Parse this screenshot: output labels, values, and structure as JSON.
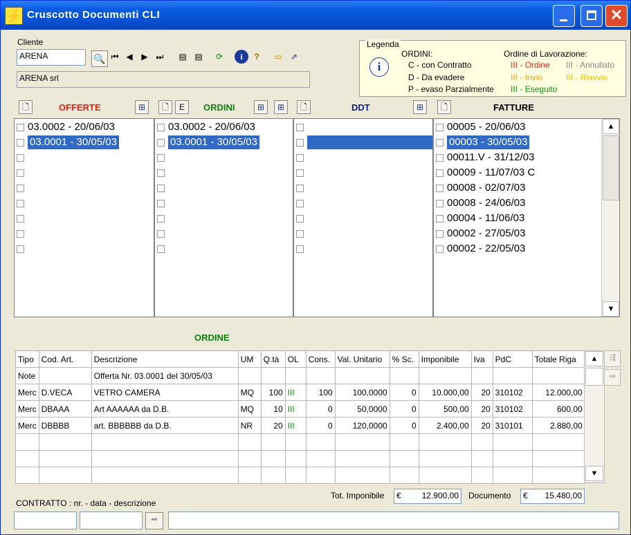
{
  "window": {
    "title": "Cruscotto Documenti CLI"
  },
  "cliente": {
    "label": "Cliente",
    "code": "ARENA",
    "name": "ARENA srl"
  },
  "legend": {
    "title": "Legenda",
    "ordini_title": "ORDINI:",
    "ordini": [
      "C - con Contratto",
      "D - Da evadere",
      "P - evaso Parzialmente"
    ],
    "ol_title": "Ordine di Lavorazione:",
    "ol": [
      {
        "mark": "III",
        "label": "- Ordine",
        "color": "#e02010"
      },
      {
        "mark": "III",
        "label": "- Annullato",
        "color": "#888888"
      },
      {
        "mark": "III",
        "label": "- Invio",
        "color": "#f0a020"
      },
      {
        "mark": "III",
        "label": "- Riavvio",
        "color": "#e8c000"
      },
      {
        "mark": "III",
        "label": "- Eseguito",
        "color": "#109010"
      }
    ]
  },
  "columns": {
    "offerte": {
      "title": "OFFERTE",
      "color": "#e02010",
      "items": [
        "03.0002 - 20/06/03",
        "03.0001 - 30/05/03",
        "",
        "",
        "",
        "",
        "",
        "",
        ""
      ]
    },
    "ordini": {
      "title": "ORDINI",
      "color": "#108010",
      "e_label": "E",
      "items": [
        "03.0002 - 20/06/03",
        "03.0001 - 30/05/03",
        "",
        "",
        "",
        "",
        "",
        "",
        ""
      ]
    },
    "ddt": {
      "title": "DDT",
      "color": "#10208a",
      "items": [
        "",
        "",
        "",
        "",
        "",
        "",
        "",
        "",
        ""
      ]
    },
    "fatture": {
      "title": "FATTURE",
      "color": "#000000",
      "items": [
        "00005 - 20/06/03",
        "00003 - 30/05/03",
        "00011.V - 31/12/03",
        "00009 - 11/07/03 C",
        "00008 - 02/07/03",
        "00008 - 24/06/03",
        "00004 - 11/06/03",
        "00002 - 27/05/03",
        "00002 - 22/05/03"
      ]
    }
  },
  "detail": {
    "title": "ORDINE",
    "headers": [
      "Tipo",
      "Cod. Art.",
      "Descrizione",
      "UM",
      "Q.tà",
      "OL",
      "Cons.",
      "Val. Unitario",
      "% Sc.",
      "Imponibile",
      "Iva",
      "PdC",
      "Totale Riga"
    ],
    "rows": [
      [
        "Note",
        "",
        "Offerta Nr. 03.0001 del 30/05/03",
        "",
        "",
        "",
        "",
        "",
        "",
        "",
        "",
        "",
        ""
      ],
      [
        "Merc",
        "D.VECA",
        "VETRO CAMERA",
        "MQ",
        "100",
        "III",
        "100",
        "100,0000",
        "0",
        "10.000,00",
        "20",
        "310102",
        "12.000,00"
      ],
      [
        "Merc",
        "DBAAA",
        "Art AAAAAA da D.B.",
        "MQ",
        "10",
        "III",
        "0",
        "50,0000",
        "0",
        "500,00",
        "20",
        "310102",
        "600,00"
      ],
      [
        "Merc",
        "DBBBB",
        "art. BBBBBB da D.B.",
        "NR",
        "20",
        "III",
        "0",
        "120,0000",
        "0",
        "2.400,00",
        "20",
        "310101",
        "2.880,00"
      ],
      [
        "",
        "",
        "",
        "",
        "",
        "",
        "",
        "",
        "",
        "",
        "",
        "",
        ""
      ],
      [
        "",
        "",
        "",
        "",
        "",
        "",
        "",
        "",
        "",
        "",
        "",
        "",
        ""
      ],
      [
        "",
        "",
        "",
        "",
        "",
        "",
        "",
        "",
        "",
        "",
        "",
        "",
        ""
      ]
    ]
  },
  "totals": {
    "imponibile_label": "Tot. Imponibile",
    "imponibile_currency": "€",
    "imponibile": "12.900,00",
    "documento_label": "Documento",
    "documento_currency": "€",
    "documento": "15.480,00"
  },
  "contratto": {
    "label": "CONTRATTO : nr. - data - descrizione"
  }
}
